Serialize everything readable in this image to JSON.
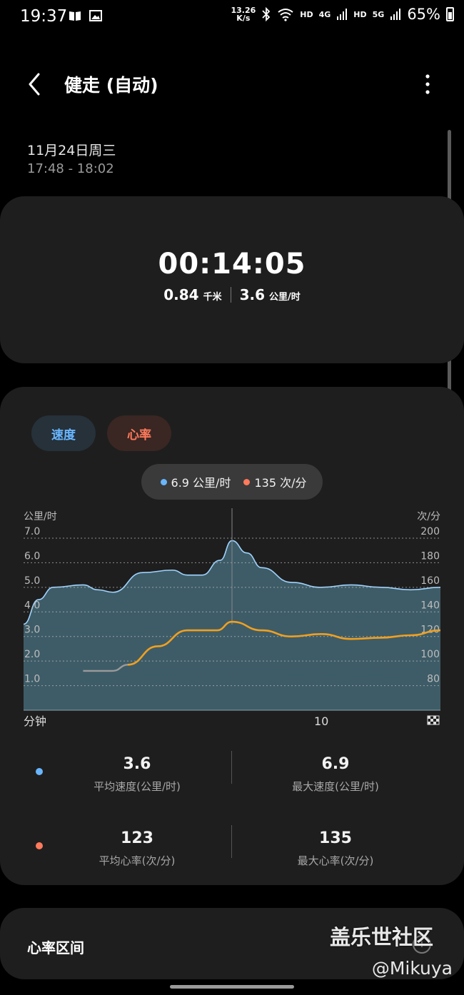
{
  "status_bar": {
    "time": "19:37",
    "net_speed_value": "13.26",
    "net_speed_unit": "K/s",
    "hd1": "HD",
    "net_4g": "4G",
    "hd2": "HD",
    "net_5g": "5G",
    "battery": "65%"
  },
  "header": {
    "title": "健走 (自动)"
  },
  "session": {
    "date": "11月24日周三",
    "time_range": "17:48 - 18:02",
    "duration": "00:14:05",
    "distance": "0.84",
    "distance_unit": "千米",
    "speed": "3.6",
    "speed_unit": "公里/时"
  },
  "tabs": {
    "speed": "速度",
    "heart_rate": "心率"
  },
  "tooltip": {
    "speed": "6.9 公里/时",
    "hr": "135 次/分"
  },
  "colors": {
    "speed": "#69b6ff",
    "hr": "#ff7a5c",
    "hr_line": "#f0a020",
    "area": "#40606c"
  },
  "chart_data": {
    "type": "area",
    "left_axis_title": "公里/时",
    "right_axis_title": "次/分",
    "y_ticks_left": [
      "7.0",
      "6.0",
      "5.0",
      "4.0",
      "3.0",
      "2.0",
      "1.0"
    ],
    "y_ticks_right": [
      "200",
      "180",
      "160",
      "140",
      "120",
      "100",
      "80"
    ],
    "x_label": "分钟",
    "x_tick": "10",
    "ylim_speed": [
      0,
      7
    ],
    "ylim_hr": [
      60,
      200
    ],
    "series": [
      {
        "name": "速度",
        "x": [
          0,
          0.5,
          1,
          2,
          2.5,
          3,
          4,
          5,
          5.5,
          6,
          6.6,
          7,
          7.5,
          8,
          9,
          10,
          11,
          12,
          13,
          14
        ],
        "values": [
          3.5,
          4.5,
          5.0,
          5.1,
          4.9,
          4.8,
          5.6,
          5.7,
          5.5,
          5.5,
          6.1,
          6.9,
          6.4,
          5.8,
          5.2,
          5.0,
          5.1,
          5.0,
          4.9,
          5.0
        ]
      },
      {
        "name": "心率",
        "x": [
          2,
          3,
          3.5,
          4.5,
          5.5,
          6.5,
          7,
          8,
          9,
          10,
          11,
          12,
          13,
          14
        ],
        "values": [
          92,
          92,
          97,
          112,
          125,
          125,
          132,
          125,
          120,
          122,
          118,
          119,
          121,
          125
        ]
      }
    ],
    "highlight_x": 7
  },
  "stats": {
    "avg_speed": "3.6",
    "avg_speed_label": "平均速度(公里/时)",
    "max_speed": "6.9",
    "max_speed_label": "最大速度(公里/时)",
    "avg_hr": "123",
    "avg_hr_label": "平均心率(次/分)",
    "max_hr": "135",
    "max_hr_label": "最大心率(次/分)"
  },
  "zones": {
    "title": "心率区间"
  },
  "watermark": {
    "site": "盖乐世社区",
    "user": "@Mikuya"
  }
}
